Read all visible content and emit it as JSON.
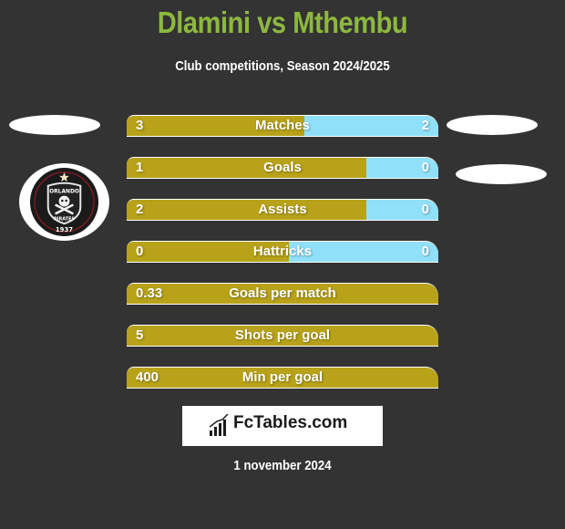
{
  "header": {
    "title": "Dlamini vs Mthembu",
    "subtitle": "Club competitions, Season 2024/2025"
  },
  "left_team": {
    "logo_icon": "orlando-pirates-crest-icon",
    "logo_text_top": "ORLANDO",
    "logo_text_bottom": "PIRATES",
    "logo_year": "1937"
  },
  "colors": {
    "left": "#b8a219",
    "right": "#90e0f9",
    "title": "#8db83f",
    "background": "#333333"
  },
  "stats": [
    {
      "label": "Matches",
      "left": "3",
      "right": "2",
      "left_share": 0.57
    },
    {
      "label": "Goals",
      "left": "1",
      "right": "0",
      "left_share": 0.77
    },
    {
      "label": "Assists",
      "left": "2",
      "right": "0",
      "left_share": 0.77
    },
    {
      "label": "Hattricks",
      "left": "0",
      "right": "0",
      "left_share": 0.52
    },
    {
      "label": "Goals per match",
      "left": "0.33",
      "right": null,
      "left_share": 1
    },
    {
      "label": "Shots per goal",
      "left": "5",
      "right": null,
      "left_share": 1
    },
    {
      "label": "Min per goal",
      "left": "400",
      "right": null,
      "left_share": 1
    }
  ],
  "footer": {
    "brand": "FcTables.com",
    "brand_icon": "bar-chart-icon",
    "date": "1 november 2024"
  }
}
